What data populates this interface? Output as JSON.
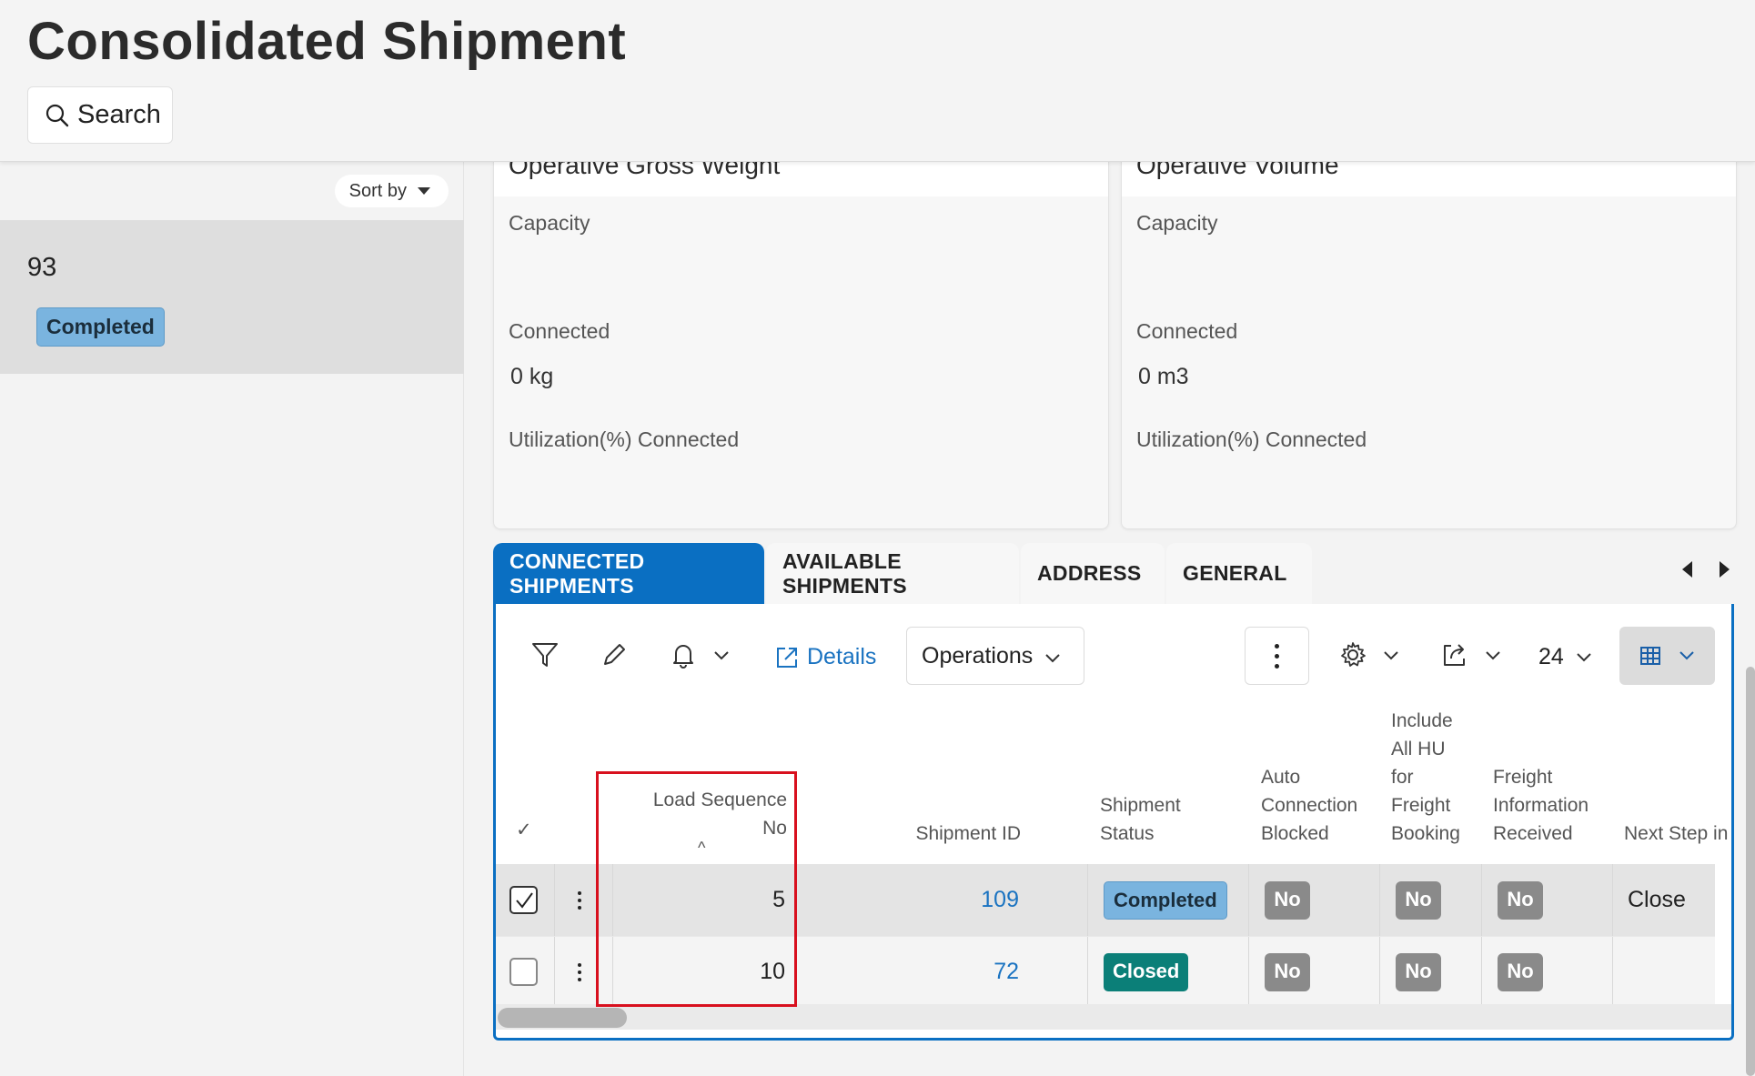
{
  "header": {
    "title": "Consolidated Shipment",
    "search_label": "Search"
  },
  "left_panel": {
    "sort_label": "Sort by",
    "items": [
      {
        "id": "93",
        "status": "Completed"
      }
    ]
  },
  "cards": [
    {
      "title": "Operative Gross Weight",
      "capacity_label": "Capacity",
      "connected_label": "Connected",
      "connected_value": "0 kg",
      "utilization_label": "Utilization(%) Connected"
    },
    {
      "title": "Operative Volume",
      "capacity_label": "Capacity",
      "connected_label": "Connected",
      "connected_value": "0 m3",
      "utilization_label": "Utilization(%) Connected"
    }
  ],
  "tabs": [
    {
      "label": "CONNECTED SHIPMENTS",
      "active": true
    },
    {
      "label": "AVAILABLE SHIPMENTS",
      "active": false
    },
    {
      "label": "ADDRESS",
      "active": false
    },
    {
      "label": "GENERAL",
      "active": false
    }
  ],
  "toolbar": {
    "details_label": "Details",
    "operations_label": "Operations",
    "page_size": "24"
  },
  "table": {
    "select_all_glyph": "✓",
    "columns": {
      "load_sequence": [
        "Load Sequence",
        "No"
      ],
      "shipment_id": [
        "Shipment ID"
      ],
      "shipment_status": [
        "Shipment",
        "Status"
      ],
      "auto_connection_blocked": [
        "Auto",
        "Connection",
        "Blocked"
      ],
      "include_all_hu": [
        "Include",
        "All HU",
        "for",
        "Freight",
        "Booking"
      ],
      "freight_info_received": [
        "Freight",
        "Information",
        "Received"
      ],
      "next_step": [
        "Next Step in"
      ]
    },
    "sort_indicator": "^",
    "rows": [
      {
        "selected": true,
        "load_sequence": "5",
        "shipment_id": "109",
        "status": "Completed",
        "auto_connection_blocked": "No",
        "include_all_hu": "No",
        "freight_info_received": "No",
        "next_step": "Close"
      },
      {
        "selected": false,
        "load_sequence": "10",
        "shipment_id": "72",
        "status": "Closed",
        "auto_connection_blocked": "No",
        "include_all_hu": "No",
        "freight_info_received": "No",
        "next_step": ""
      }
    ]
  },
  "colors": {
    "accent": "#0a6fc2",
    "completed_badge": "#7ab4df",
    "closed_badge": "#0b7f78",
    "no_badge": "#8a8a8a",
    "highlight": "#d8101e"
  }
}
